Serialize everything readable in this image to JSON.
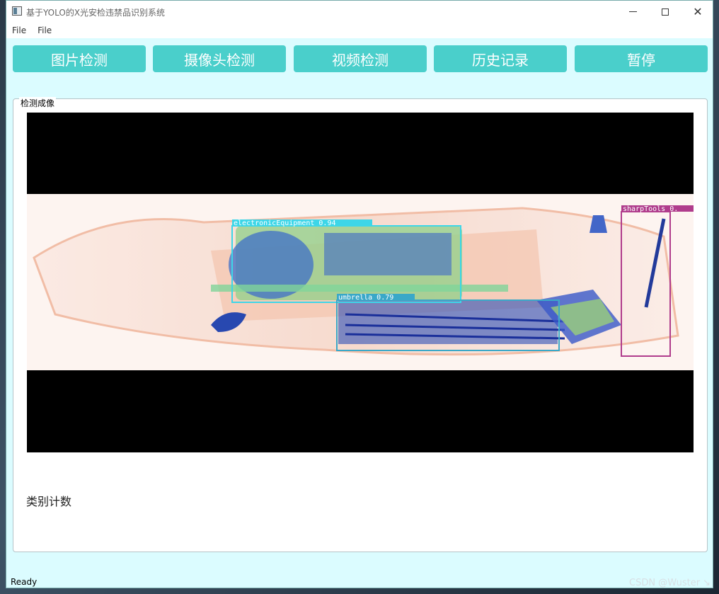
{
  "window": {
    "title": "基于YOLO的X光安检违禁品识别系统"
  },
  "menu": {
    "items": [
      "File",
      "File"
    ]
  },
  "toolbar": {
    "buttons": [
      "图片检测",
      "摄像头检测",
      "视频检测",
      "历史记录",
      "暂停"
    ],
    "button_color": "#4acfcb"
  },
  "panel": {
    "title": "检测成像",
    "count_label": "类别计数"
  },
  "detections": [
    {
      "label": "electronicEquipment 0.94",
      "color": "#3dd6e8"
    },
    {
      "label": "umbrella 0.79",
      "color": "#3aa8c8"
    },
    {
      "label": "sharpTools 0.",
      "color": "#b03c8c"
    }
  ],
  "status": {
    "text": "Ready"
  },
  "watermark": "CSDN @Wuster ↘"
}
